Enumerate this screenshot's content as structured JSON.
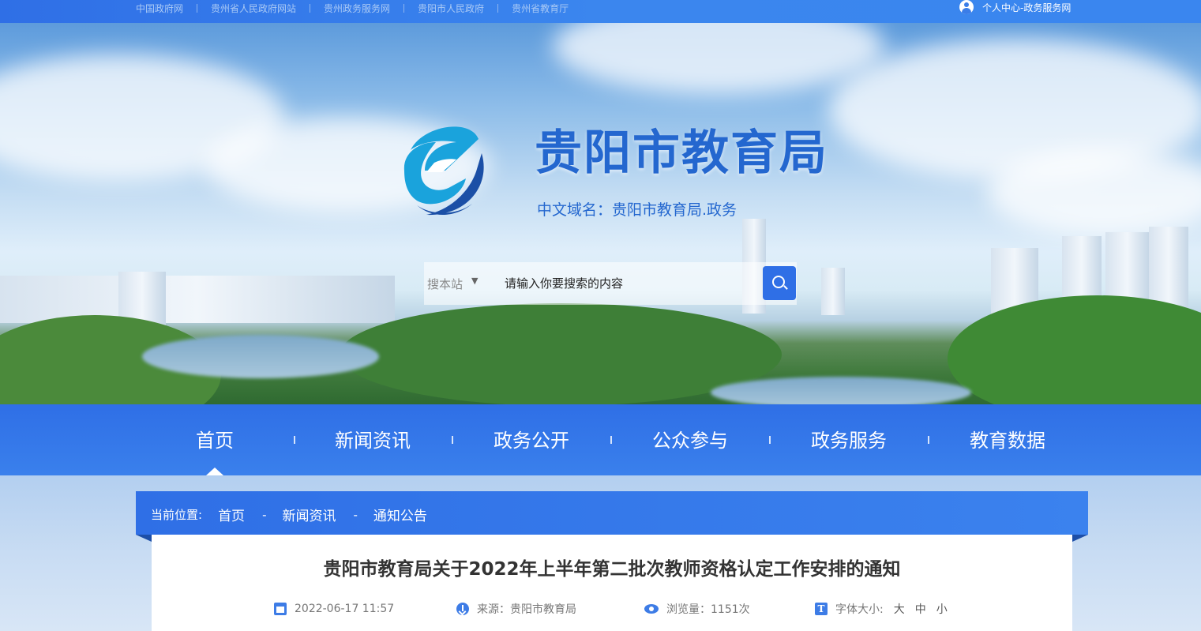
{
  "top_links": [
    "中国政府网",
    "贵州省人民政府网站",
    "贵州政务服务网",
    "贵阳市人民政府",
    "贵州省教育厅"
  ],
  "user_center": "个人中心-政务服务网",
  "site": {
    "title": "贵阳市教育局",
    "domain": "中文域名：贵阳市教育局.政务"
  },
  "search": {
    "scope": "搜本站",
    "placeholder": "请输入你要搜索的内容"
  },
  "nav": [
    "首页",
    "新闻资讯",
    "政务公开",
    "公众参与",
    "政务服务",
    "教育数据"
  ],
  "breadcrumb": {
    "label": "当前位置:",
    "items": [
      "首页",
      "新闻资讯",
      "通知公告"
    ],
    "separator": "-"
  },
  "article": {
    "title": "贵阳市教育局关于2022年上半年第二批次教师资格认定工作安排的通知",
    "date": "2022-06-17 11:57",
    "source": "来源：贵阳市教育局",
    "views": "浏览量：1151次",
    "font_size_label": "字体大小:",
    "font_sizes": [
      "大",
      "中",
      "小"
    ]
  },
  "colors": {
    "primary": "#2f6fe6",
    "title_blue": "#2467cf"
  }
}
